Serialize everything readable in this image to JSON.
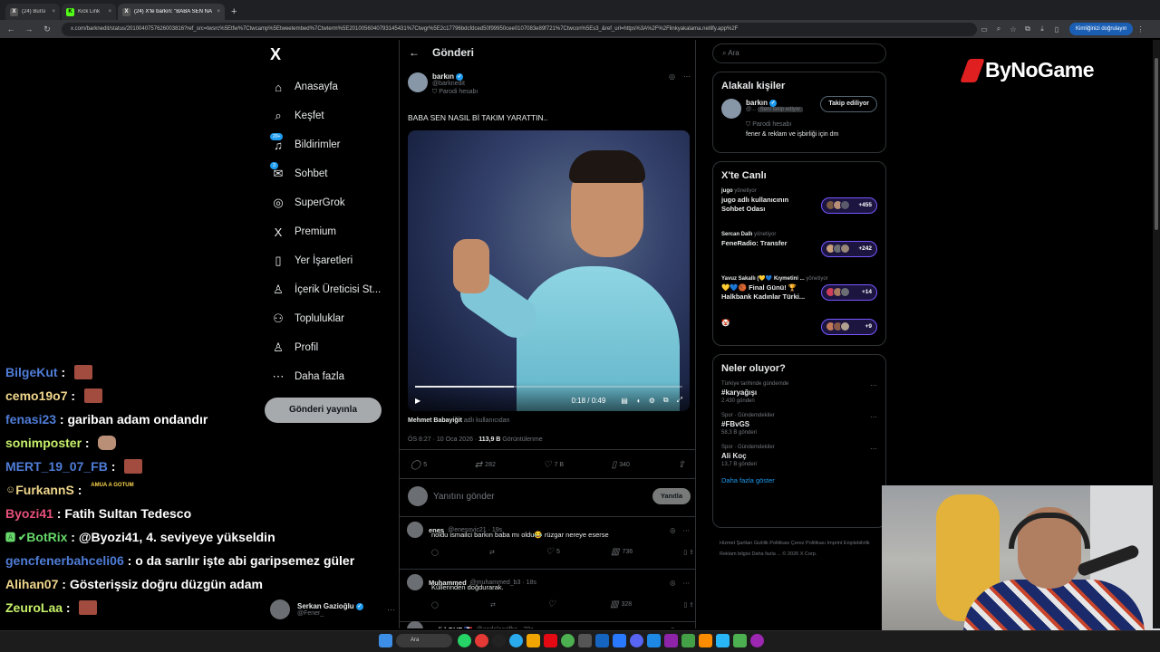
{
  "browser": {
    "tabs": [
      {
        "icon": "X",
        "title": "(24) Bursı"
      },
      {
        "icon": "K",
        "title": "Kick Link"
      },
      {
        "icon": "X",
        "title": "(24) X'te barkın: \"BABA SEN NA"
      }
    ],
    "new_tab": "+",
    "url": "x.com/barknedit/status/2010040757626003816?ref_src=twsrc%5Etfw%7Ctwcamp%5Etweetembed%7Ctwterm%5E2010056040793145431%7Ctwgr%5E2c17796bdcfdced50f99950cee0107083e89f721%7Ctwcon%5Es3_&ref_url=https%3A%2F%2Flinkyakalama.netlify.app%2F",
    "verify_label": "Kimliğinizi doğrulayın"
  },
  "nav": {
    "logo": "X",
    "items": [
      {
        "icon": "home-icon",
        "glyph": "⌂",
        "label": "Anasayfa"
      },
      {
        "icon": "search-icon",
        "glyph": "⌕",
        "label": "Keşfet"
      },
      {
        "icon": "bell-icon",
        "glyph": "♫",
        "label": "Bildirimler",
        "badge": "20+"
      },
      {
        "icon": "mail-icon",
        "glyph": "✉",
        "label": "Sohbet",
        "badge": "3"
      },
      {
        "icon": "grok-icon",
        "glyph": "◎",
        "label": "SuperGrok"
      },
      {
        "icon": "x-premium-icon",
        "glyph": "X",
        "label": "Premium"
      },
      {
        "icon": "bookmark-icon",
        "glyph": "▯",
        "label": "Yer İşaretleri"
      },
      {
        "icon": "creator-icon",
        "glyph": "♙",
        "label": "İçerik Üreticisi St..."
      },
      {
        "icon": "communities-icon",
        "glyph": "⚇",
        "label": "Topluluklar"
      },
      {
        "icon": "profile-icon",
        "glyph": "♙",
        "label": "Profil"
      },
      {
        "icon": "more-icon",
        "glyph": "⋯",
        "label": "Daha fazla"
      }
    ],
    "post_button": "Gönderi yayınla",
    "user": {
      "name": "Serkan Gazioğlu",
      "handle": "@Fener_"
    }
  },
  "main": {
    "title": "Gönderi",
    "tweet": {
      "author": "barkın",
      "handle": "@barknedit",
      "label": "Parodi hesabı",
      "text": "BABA SEN NASIL Bİ TAKIM YARATTIN..",
      "video": {
        "time": "0:18 / 0:49",
        "progress": 0.37
      },
      "tagged": "Mehmet Babayiğit",
      "tagged_suffix": "adlı kullanıcıdan",
      "meta_time": "ÖS 8:27 · 10 Oca 2026 · ",
      "views": "113,9 B",
      "views_label": "Görüntülenme",
      "replies": "5",
      "retweets": "282",
      "likes": "7 B",
      "bookmarks": "340"
    },
    "reply_placeholder": "Yanıtını gönder",
    "reply_button": "Yanıtla",
    "replies": [
      {
        "name": "enes",
        "handle": "@enesovic21 · 19s",
        "text": "noldu ismailci barkın baba mı oldu😂 rüzgar nereye eserse",
        "likes": "5",
        "views": "736"
      },
      {
        "name": "Muhammed",
        "handle": "@muhammed_b3 · 18s",
        "text": "Küllerinden doğdurarak.",
        "likes": "",
        "views": "328"
      },
      {
        "name": "mali | GUF 🇫🇷",
        "handle": "@andalaarjfha · 20s",
        "text": "",
        "likes": "",
        "views": ""
      }
    ]
  },
  "right": {
    "search_placeholder": "Ara",
    "relevant": {
      "title": "Alakalı kişiler",
      "name": "barkın",
      "handle": "@...",
      "follows_you": "Seni takip ediyor",
      "follow_button": "Takip ediliyor",
      "label": "Parodi hesabı",
      "bio": "fener & reklam ve işbirliği için dm"
    },
    "live": {
      "title": "X'te Canlı",
      "spaces": [
        {
          "host": "jugo",
          "host_suffix": "yönetiyor",
          "title": "jugo adlı kullanıcının Sohbet Odası",
          "count": "+455"
        },
        {
          "host": "Sercan Dallı",
          "host_suffix": "yönetiyor",
          "title": "FeneRadio: Transfer",
          "count": "+242"
        },
        {
          "host": "Yavuz Sakallı (💛💙 Kıymetini ...",
          "host_suffix": "yönetiyor",
          "title": "💛💙🏀 Final Günü! 🏆 Halkbank Kadınlar Türki...",
          "count": "+14"
        },
        {
          "host": "",
          "host_suffix": "",
          "title": "🤡",
          "count": "+9"
        }
      ]
    },
    "trends": {
      "title": "Neler oluyor?",
      "items": [
        {
          "context": "Türkiye tarihinde gündemde",
          "name": "#karyağışı",
          "count": "2.430 gönderi"
        },
        {
          "context": "Spor · Gündemdekiler",
          "name": "#FBvGS",
          "count": "58,3 B gönderi"
        },
        {
          "context": "Spor · Gündemdekiler",
          "name": "Ali Koç",
          "count": "13,7 B gönderi"
        }
      ],
      "more": "Daha fazla göster"
    },
    "footer": "Hizmet Şartları   Gizlilik Politikası   Çerez Politikası   Imprint   Erişilebilirlik   Reklam bilgisi   Daha fazla ...   © 2026 X Corp."
  },
  "overlay": {
    "brand": "ByNoGame"
  },
  "chat": [
    {
      "user": "BilgeKut",
      "color": "#4f7dd8",
      "msg": "",
      "emote": "pixel"
    },
    {
      "user": "cemo19o7",
      "color": "#f0d78c",
      "msg": "",
      "emote": "pixel"
    },
    {
      "user": "fenasi23",
      "color": "#4f7dd8",
      "msg": "gariban adam ondandır",
      "emote": ""
    },
    {
      "user": "sonimposter",
      "color": "#c6f06a",
      "msg": "",
      "emote": "face"
    },
    {
      "user": "MERT_19_07_FB",
      "color": "#4f7dd8",
      "msg": "",
      "emote": "pixel"
    },
    {
      "user": "FurkannS",
      "color": "#f0d78c",
      "msg": "",
      "emote": "text",
      "prefix": "☺ "
    },
    {
      "user": "Byozi41",
      "color": "#e7507a",
      "msg": "Fatih Sultan Tedesco",
      "emote": ""
    },
    {
      "user": "BotRix",
      "color": "#66d86a",
      "msg": "@Byozi41, 4. seviyeye yükseldin",
      "emote": "",
      "prefix": "🅰 ✔ "
    },
    {
      "user": "gencfenerbahceli06",
      "color": "#4f7dd8",
      "msg": "o da sarılır işte abi garipsemez güler",
      "emote": ""
    },
    {
      "user": "Alihan07",
      "color": "#f0d78c",
      "msg": "Gösterişsiz doğru düzgün adam",
      "emote": ""
    },
    {
      "user": "ZeuroLaa",
      "color": "#c6f06a",
      "msg": "",
      "emote": "pixel"
    }
  ],
  "chat_emote_text": "AMUA A GOTUM",
  "taskbar": {
    "search": "Ara"
  }
}
